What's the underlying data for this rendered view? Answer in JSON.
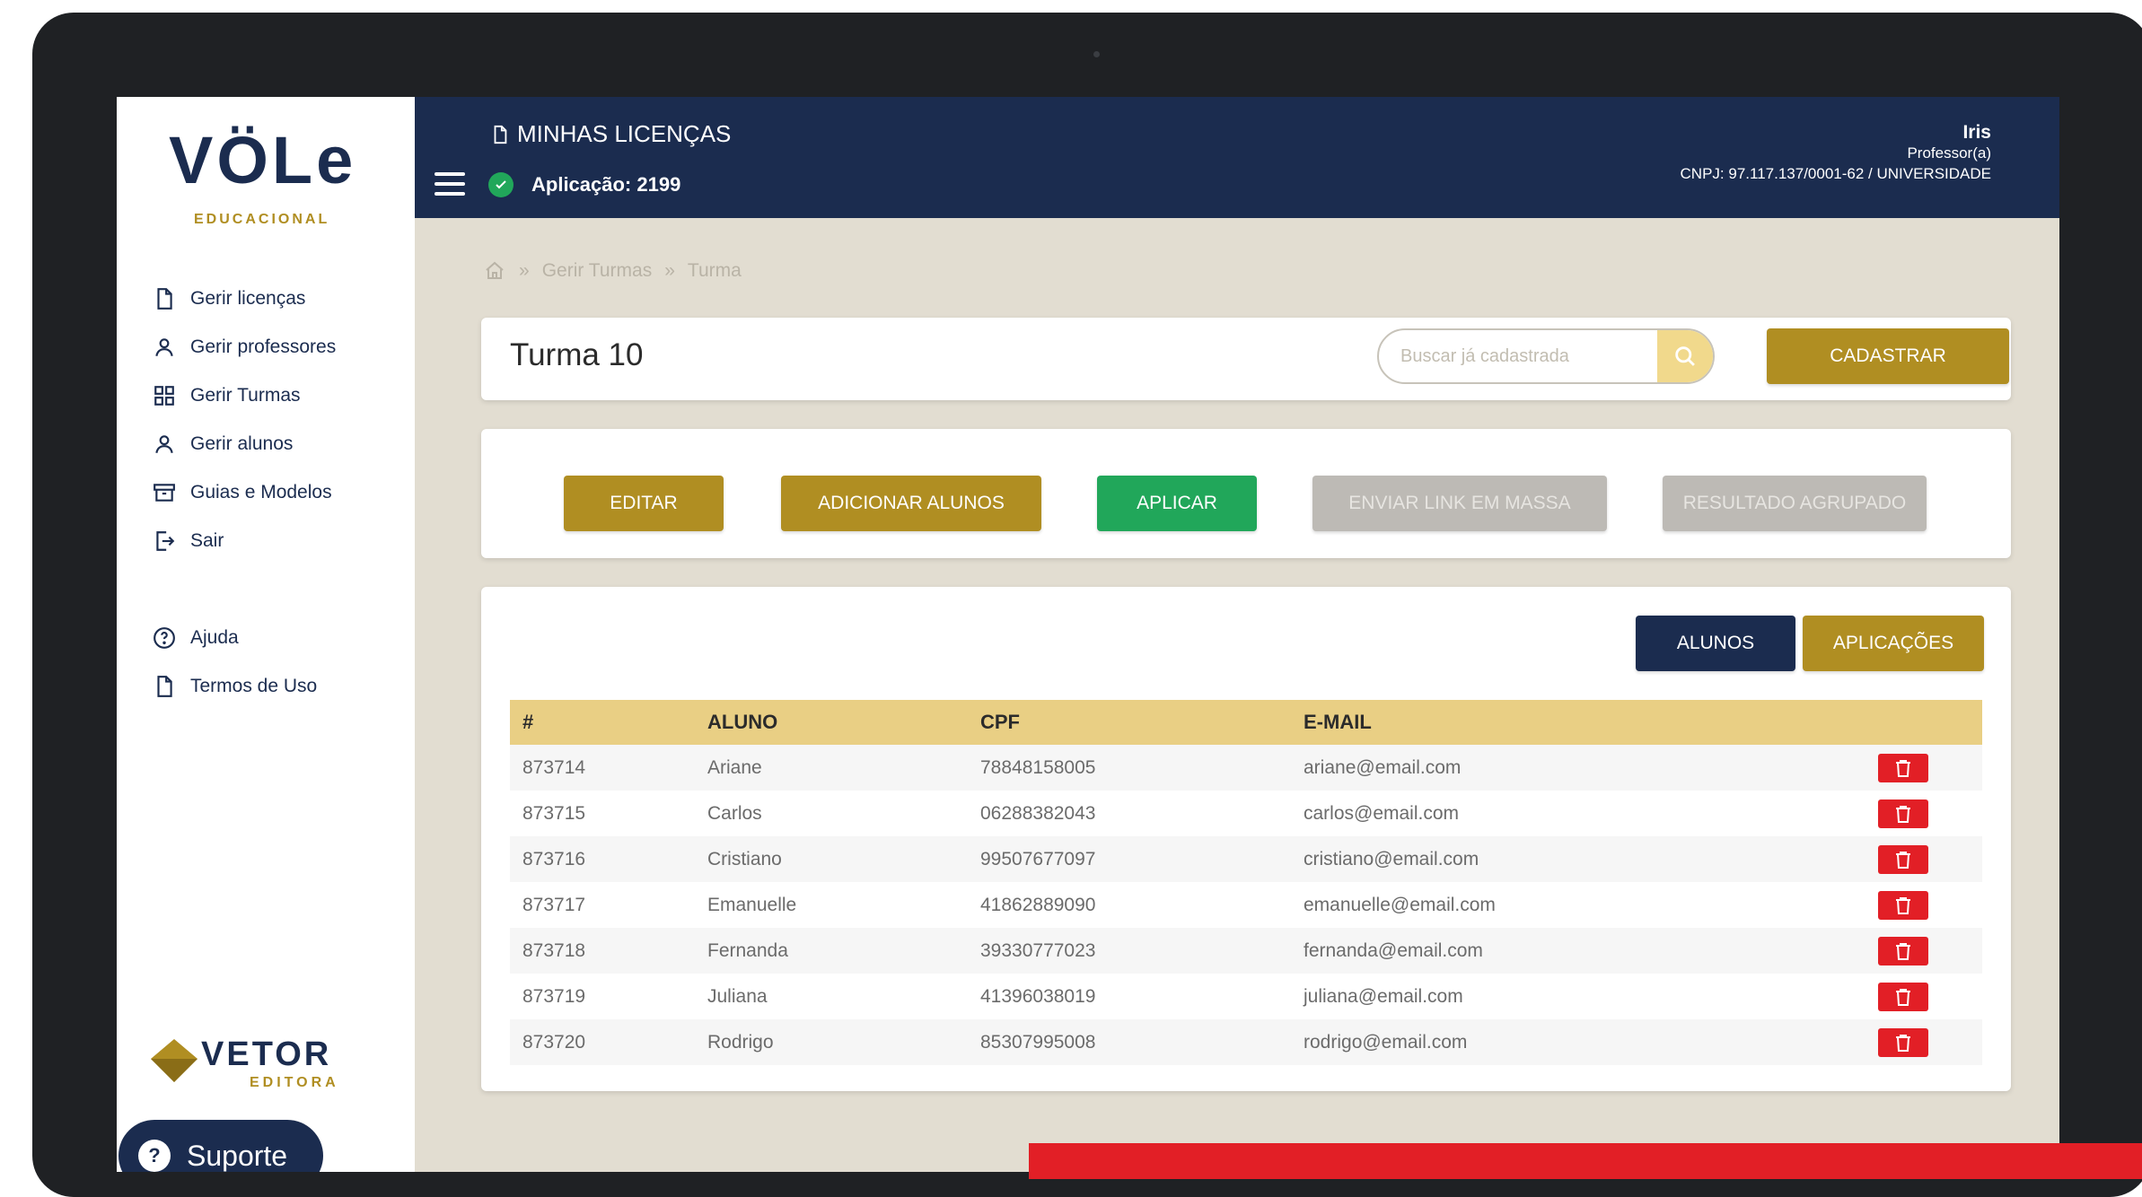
{
  "brand": {
    "logo": "VÖLe",
    "logo_tag": "EDUCACIONAL",
    "footer_logo": "VETOR",
    "footer_tag": "EDITORA"
  },
  "sidebar": {
    "items": [
      {
        "label": "Gerir licenças",
        "icon": "document-icon"
      },
      {
        "label": "Gerir professores",
        "icon": "user-icon"
      },
      {
        "label": "Gerir Turmas",
        "icon": "grid-icon"
      },
      {
        "label": "Gerir alunos",
        "icon": "user-icon"
      },
      {
        "label": "Guias e Modelos",
        "icon": "archive-icon"
      },
      {
        "label": "Sair",
        "icon": "logout-icon"
      }
    ],
    "secondary": [
      {
        "label": "Ajuda",
        "icon": "help-icon"
      },
      {
        "label": "Termos de Uso",
        "icon": "document-icon"
      }
    ],
    "support_label": "Suporte"
  },
  "header": {
    "title": "MINHAS LICENÇAS",
    "application": "Aplicação: 2199",
    "user_name": "Iris",
    "user_role": "Professor(a)",
    "user_org": "CNPJ: 97.117.137/0001-62 / UNIVERSIDADE"
  },
  "breadcrumb": [
    "Gerir Turmas",
    "Turma"
  ],
  "class_card": {
    "title": "Turma 10",
    "search_placeholder": "Buscar já cadastrada",
    "register_label": "CADASTRAR"
  },
  "actions": {
    "edit": "EDITAR",
    "add_students": "ADICIONAR ALUNOS",
    "apply": "APLICAR",
    "send_link": "ENVIAR LINK EM MASSA",
    "grouped_result": "RESULTADO AGRUPADO"
  },
  "tabs": {
    "students": "ALUNOS",
    "applications": "APLICAÇÕES"
  },
  "table": {
    "headers": [
      "#",
      "ALUNO",
      "CPF",
      "E-MAIL"
    ],
    "rows": [
      {
        "id": "873714",
        "name": "Ariane",
        "cpf": "78848158005",
        "email": "ariane@email.com"
      },
      {
        "id": "873715",
        "name": "Carlos",
        "cpf": "06288382043",
        "email": "carlos@email.com"
      },
      {
        "id": "873716",
        "name": "Cristiano",
        "cpf": "99507677097",
        "email": "cristiano@email.com"
      },
      {
        "id": "873717",
        "name": "Emanuelle",
        "cpf": "41862889090",
        "email": "emanuelle@email.com"
      },
      {
        "id": "873718",
        "name": "Fernanda",
        "cpf": "39330777023",
        "email": "fernanda@email.com"
      },
      {
        "id": "873719",
        "name": "Juliana",
        "cpf": "41396038019",
        "email": "juliana@email.com"
      },
      {
        "id": "873720",
        "name": "Rodrigo",
        "cpf": "85307995008",
        "email": "rodrigo@email.com"
      }
    ]
  },
  "colors": {
    "navy": "#1b2c4f",
    "gold": "#b08e22",
    "green": "#21a75a",
    "red": "#e21f26",
    "background": "#e2ddd1"
  }
}
